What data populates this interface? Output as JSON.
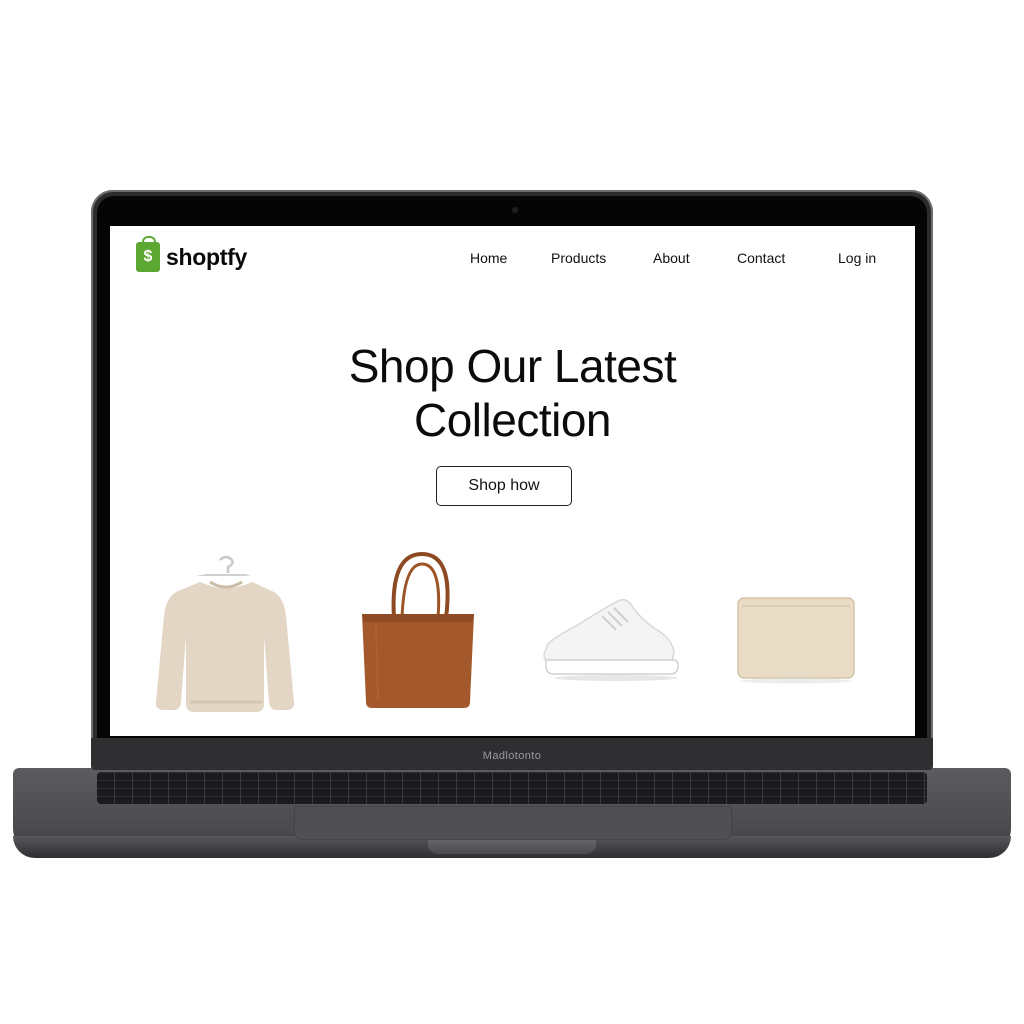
{
  "site": {
    "logo_text": "shoptfy",
    "logo_glyph": "$",
    "brand_color": "#5da832"
  },
  "nav": {
    "home": "Home",
    "products": "Products",
    "about": "About",
    "contact": "Contact",
    "login": "Log in"
  },
  "hero": {
    "title_line1": "Shop Our Latest",
    "title_line2": "Collection",
    "cta_label": "Shop how"
  },
  "products": [
    {
      "name": "sweatshirt",
      "color": "#e3d6c4"
    },
    {
      "name": "tote-bag",
      "color": "#a4592c"
    },
    {
      "name": "sneaker",
      "color": "#f4f4f4"
    },
    {
      "name": "pouch",
      "color": "#e9dcc7"
    }
  ],
  "device": {
    "chin_label": "Madlotonto"
  }
}
